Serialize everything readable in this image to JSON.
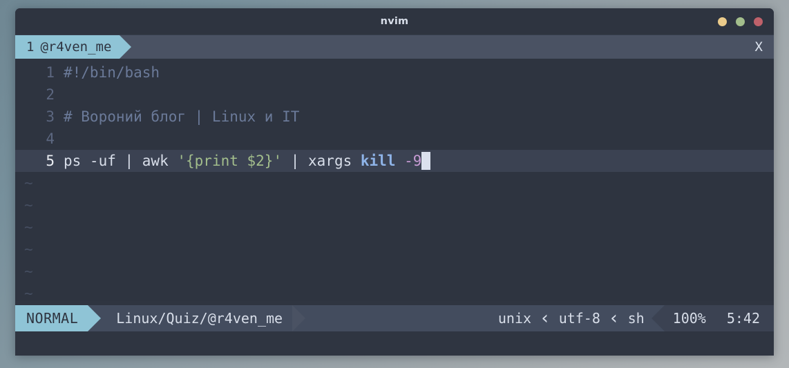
{
  "window": {
    "title": "nvim",
    "controls": [
      {
        "name": "minimize",
        "color": "#ebcb8b"
      },
      {
        "name": "maximize",
        "color": "#a3be8c"
      },
      {
        "name": "close",
        "color": "#bf616a"
      }
    ]
  },
  "bufferline": {
    "tab_number": "1",
    "tab_label": "@r4ven_me",
    "close_label": "X"
  },
  "editor": {
    "lines": [
      {
        "number": "1",
        "current": false,
        "tokens": [
          {
            "text": "#!/bin/bash",
            "type": "comment"
          }
        ]
      },
      {
        "number": "2",
        "current": false,
        "tokens": [
          {
            "text": "",
            "type": "plain"
          }
        ]
      },
      {
        "number": "3",
        "current": false,
        "tokens": [
          {
            "text": "# Вороний блог | Linux и IT",
            "type": "comment"
          }
        ]
      },
      {
        "number": "4",
        "current": false,
        "tokens": [
          {
            "text": "",
            "type": "plain"
          }
        ]
      },
      {
        "number": "5",
        "current": true,
        "tokens": [
          {
            "text": "ps -uf | awk ",
            "type": "plain"
          },
          {
            "text": "'{print $2}'",
            "type": "string"
          },
          {
            "text": " | xargs ",
            "type": "plain"
          },
          {
            "text": "kill",
            "type": "cmd"
          },
          {
            "text": " ",
            "type": "plain"
          },
          {
            "text": "-9",
            "type": "flag"
          },
          {
            "text": "",
            "type": "cursor"
          }
        ]
      }
    ],
    "empty_marker": "~",
    "empty_marker_count": 6
  },
  "statusline": {
    "mode": "NORMAL",
    "path": "Linux/Quiz/@r4ven_me",
    "fileformat": "unix",
    "encoding": "utf-8",
    "filetype": "sh",
    "percent": "100%",
    "position": "5:42",
    "chevron": "‹"
  },
  "colors": {
    "accent": "#8fc4d6",
    "editor_bg": "#2e3440",
    "cursorline_bg": "#3b4252",
    "statusline_bg": "#434c5e",
    "bufferline_bg": "#4a5263",
    "comment": "#6b7a99",
    "string": "#a3be8c",
    "command": "#8fb4e8",
    "flag": "#c79bd4",
    "text": "#d8dee9"
  }
}
